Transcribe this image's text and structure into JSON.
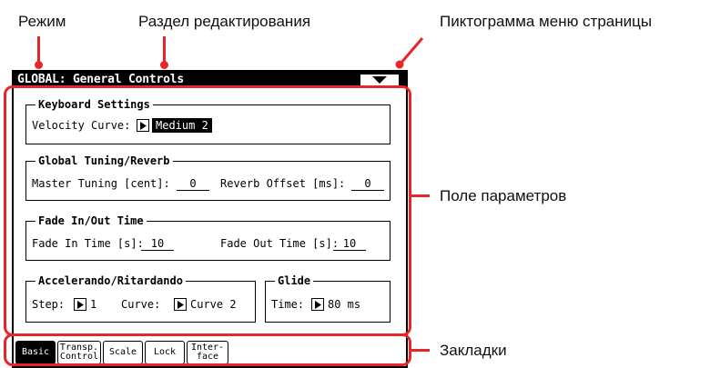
{
  "annotations": {
    "mode": "Режим",
    "edit_section": "Раздел редактирования",
    "page_menu_icon": "Пиктограмма меню страницы",
    "parameter_area": "Поле параметров",
    "tabs": "Закладки"
  },
  "screen": {
    "title": "GLOBAL: General Controls",
    "menu_icon": "triangle-down-icon"
  },
  "keyboard_settings": {
    "title": "Keyboard Settings",
    "velocity_curve_label": "Velocity Curve:",
    "velocity_curve_value": "Medium 2"
  },
  "global_tuning": {
    "title": "Global Tuning/Reverb",
    "master_tuning_label": "Master Tuning [cent]:",
    "master_tuning_value": "0",
    "reverb_offset_label": "Reverb Offset [ms]:",
    "reverb_offset_value": "0"
  },
  "fade": {
    "title": "Fade In/Out Time",
    "fade_in_label": "Fade In Time [s]:",
    "fade_in_value": "10",
    "fade_out_label": "Fade Out Time [s]:",
    "fade_out_value": "10"
  },
  "accelerando": {
    "title": "Accelerando/Ritardando",
    "step_label": "Step:",
    "step_value": "1",
    "curve_label": "Curve:",
    "curve_value": "Curve 2"
  },
  "glide": {
    "title": "Glide",
    "time_label": "Time:",
    "time_value": "80 ms"
  },
  "tabs": {
    "basic": "Basic",
    "transp_line1": "Transp.",
    "transp_line2": "Control",
    "scale": "Scale",
    "lock": "Lock",
    "interface_line1": "Inter-",
    "interface_line2": "face"
  },
  "colors": {
    "accent": "#e8262a",
    "screen_fg": "#000000",
    "screen_bg": "#ffffff"
  }
}
